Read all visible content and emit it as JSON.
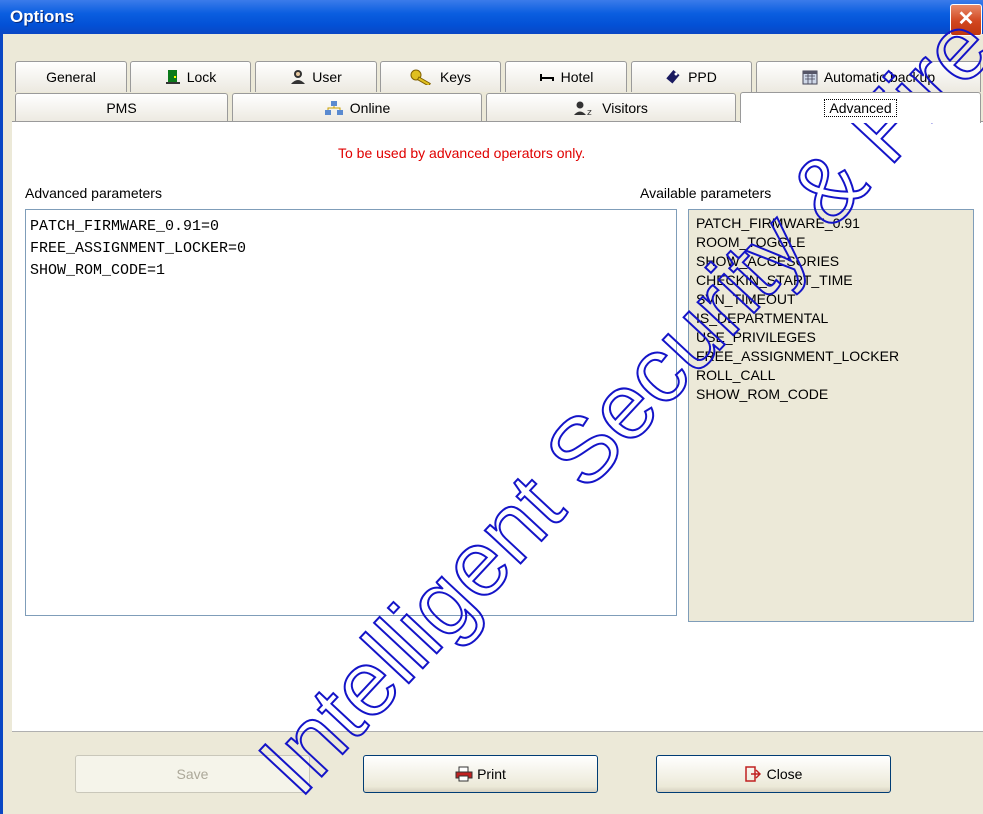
{
  "window": {
    "title": "Options",
    "close_glyph": "✕"
  },
  "tabs_row1": [
    {
      "label": "General",
      "icon": "none"
    },
    {
      "label": "Lock",
      "icon": "door-icon"
    },
    {
      "label": "User",
      "icon": "user-icon"
    },
    {
      "label": "Keys",
      "icon": "key-icon"
    },
    {
      "label": "Hotel",
      "icon": "bed-icon"
    },
    {
      "label": "PPD",
      "icon": "ppd-device-icon"
    },
    {
      "label": "Automatic backup",
      "icon": "calendar-icon"
    }
  ],
  "tabs_row2": [
    {
      "label": "PMS",
      "icon": "none"
    },
    {
      "label": "Online",
      "icon": "network-icon"
    },
    {
      "label": "Visitors",
      "icon": "visitors-icon"
    },
    {
      "label": "Advanced",
      "icon": "none",
      "active": true
    }
  ],
  "advanced": {
    "warning": "To be used by advanced operators only.",
    "params_label": "Advanced parameters",
    "params_lines": [
      "PATCH_FIRMWARE_0.91=0",
      "FREE_ASSIGNMENT_LOCKER=0",
      "SHOW_ROM_CODE=1"
    ],
    "available_label": "Available parameters",
    "available": [
      "PATCH_FIRMWARE_0.91",
      "ROOM_TOGGLE",
      "SHOW_ACCESORIES",
      "CHECKIN_START_TIME",
      "SVN_TIMEOUT",
      "IS_DEPARTMENTAL",
      "USE_PRIVILEGES",
      "FREE_ASSIGNMENT_LOCKER",
      "ROLL_CALL",
      "SHOW_ROM_CODE"
    ]
  },
  "buttons": {
    "save": "Save",
    "print": "Print",
    "close": "Close"
  },
  "watermark": {
    "text": "Intelligent Security & Fire",
    "color": "#1414c8"
  },
  "colors": {
    "titlebar": "#0a5ee0",
    "warning": "#e00000",
    "panel_bg": "#ece9d8"
  }
}
